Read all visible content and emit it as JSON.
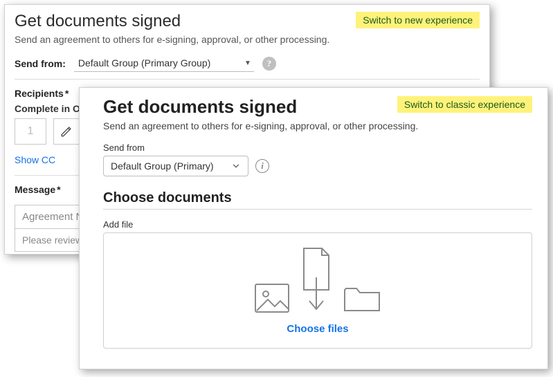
{
  "classic": {
    "title": "Get documents signed",
    "subtitle": "Send an agreement to others for e-signing, approval, or other processing.",
    "switch_link": "Switch to new experience",
    "send_from_label": "Send from:",
    "send_from_value": "Default Group (Primary Group)",
    "recipients_label": "Recipients",
    "complete_in_order": "Complete in Ord",
    "order_value": "1",
    "show_cc": "Show CC",
    "message_label": "Message",
    "agreement_name_placeholder": "Agreement N",
    "review_placeholder": "Please review a"
  },
  "modern": {
    "title": "Get documents signed",
    "subtitle": "Send an agreement to others for e-signing, approval, or other processing.",
    "switch_link": "Switch to classic experience",
    "send_from_label": "Send from",
    "send_from_value": "Default Group (Primary)",
    "choose_documents": "Choose documents",
    "add_file_label": "Add file",
    "choose_files": "Choose files"
  }
}
